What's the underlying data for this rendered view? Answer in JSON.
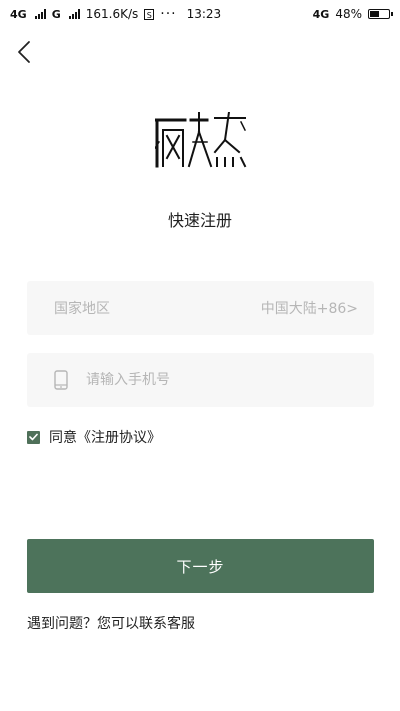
{
  "status_bar": {
    "network_1": "4G",
    "network_2": "G",
    "speed": "161.6K/s",
    "sim_badge": "S",
    "more_dots": "···",
    "time": "13:23",
    "network_right": "4G",
    "battery_percent": "48%",
    "battery_level": 0.48
  },
  "header": {
    "back_icon": "chevron-left-icon"
  },
  "brand": {
    "logo": "brand-logo"
  },
  "page": {
    "title": "快速注册"
  },
  "form": {
    "country_label": "国家地区",
    "country_value": "中国大陆+86>",
    "phone_placeholder": "请输入手机号",
    "phone_value": "",
    "phone_icon": "mobile-phone-icon"
  },
  "agreement": {
    "checked": true,
    "text": "同意《注册协议》"
  },
  "actions": {
    "next_label": "下一步",
    "help_text": "遇到问题？您可以联系客服"
  },
  "colors": {
    "primary": "#4d735b",
    "field_bg": "#f7f7f7",
    "placeholder": "#b6b6b6"
  }
}
